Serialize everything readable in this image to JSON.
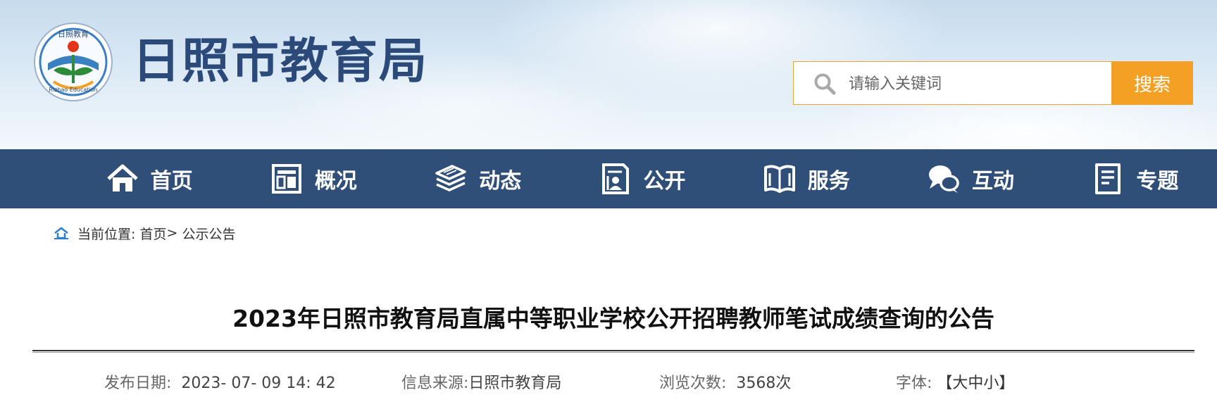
{
  "header": {
    "site_title": "日照市教育局",
    "logo": {
      "top_text": "日照教育",
      "bottom_text": "Rizhao Education"
    }
  },
  "search": {
    "placeholder": "请输入关键词",
    "button_label": "搜索",
    "accent_color": "#f4a024"
  },
  "nav": {
    "bg_color": "#2f4f78",
    "items": [
      {
        "label": "首页",
        "icon": "home-icon"
      },
      {
        "label": "概况",
        "icon": "overview-icon"
      },
      {
        "label": "动态",
        "icon": "news-stack-icon"
      },
      {
        "label": "公开",
        "icon": "disclosure-icon"
      },
      {
        "label": "服务",
        "icon": "book-icon"
      },
      {
        "label": "互动",
        "icon": "chat-bubbles-icon"
      },
      {
        "label": "专题",
        "icon": "document-icon"
      }
    ]
  },
  "breadcrumb": {
    "prefix": "当前位置:",
    "home": "首页",
    "separator": ">",
    "current": "公示公告"
  },
  "article": {
    "title": "2023年日照市教育局直属中等职业学校公开招聘教师笔试成绩查询的公告",
    "publish_label": "发布日期:",
    "publish_value": "2023- 07- 09 14: 42",
    "source_label": "信息来源:",
    "source_value": "日照市教育局",
    "views_label": "浏览次数:",
    "views_value": "3568次",
    "font_label": "字体:",
    "font_options": "【大中小】"
  }
}
